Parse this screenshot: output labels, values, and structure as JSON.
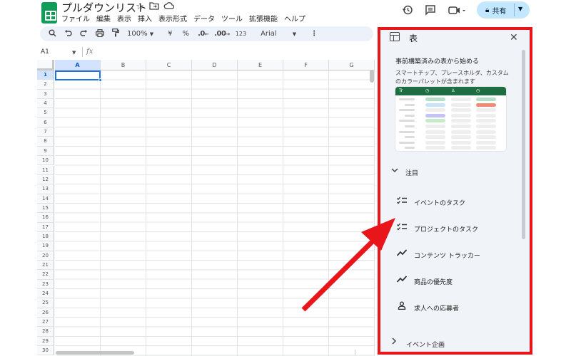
{
  "header": {
    "doc_title": "プルダウンリスト",
    "menu": [
      "ファイル",
      "編集",
      "表示",
      "挿入",
      "表示形式",
      "データ",
      "ツール",
      "拡張機能",
      "ヘルプ"
    ],
    "share_label": "共有",
    "icons": [
      "star-icon",
      "move-folder-icon",
      "cloud-status-icon",
      "history-icon",
      "comment-icon",
      "meet-icon"
    ]
  },
  "toolbar": {
    "zoom": "100%",
    "currency": "¥",
    "percent": "%",
    "decrease_decimal": ".0",
    "increase_decimal": ".00",
    "number_format": "123",
    "font": "Arial"
  },
  "formula_bar": {
    "name_box": "A1",
    "fx": "fx"
  },
  "grid": {
    "columns": [
      "A",
      "B",
      "C",
      "D",
      "E",
      "F",
      "G"
    ],
    "rows": [
      "1",
      "2",
      "3",
      "4",
      "5",
      "6",
      "7",
      "8",
      "9",
      "10",
      "11",
      "12",
      "13",
      "14",
      "15",
      "16",
      "17",
      "18",
      "19",
      "20",
      "21",
      "22",
      "23",
      "24",
      "25",
      "26",
      "27",
      "28",
      "29",
      "30"
    ],
    "selected_cell": "A1"
  },
  "side_panel": {
    "title": "表",
    "prebuilt_heading": "事前構築済みの表から始める",
    "prebuilt_desc": "スマートチップ、プレースホルダ、カスタムのカラーパレットが含まれます",
    "preview_header": [
      "Tr",
      "◷",
      "♙",
      "◷"
    ],
    "pinned_label": "注目",
    "templates": [
      {
        "icon": "checklist-icon",
        "label": "イベントのタスク"
      },
      {
        "icon": "checklist-icon",
        "label": "プロジェクトのタスク"
      },
      {
        "icon": "trend-icon",
        "label": "コンテンツ トラッカー"
      },
      {
        "icon": "trend-icon",
        "label": "商品の優先度"
      },
      {
        "icon": "person-icon",
        "label": "求人への応募者"
      }
    ],
    "event_section_label": "イベント企画"
  },
  "colors": {
    "highlight_border": "#e8151a",
    "arrow": "#e8151a",
    "share_bg": "#c2e7ff",
    "toolbar_bg": "#edf2fa",
    "panel_bg": "#f0f4f9",
    "logo": "#0f9d58"
  }
}
